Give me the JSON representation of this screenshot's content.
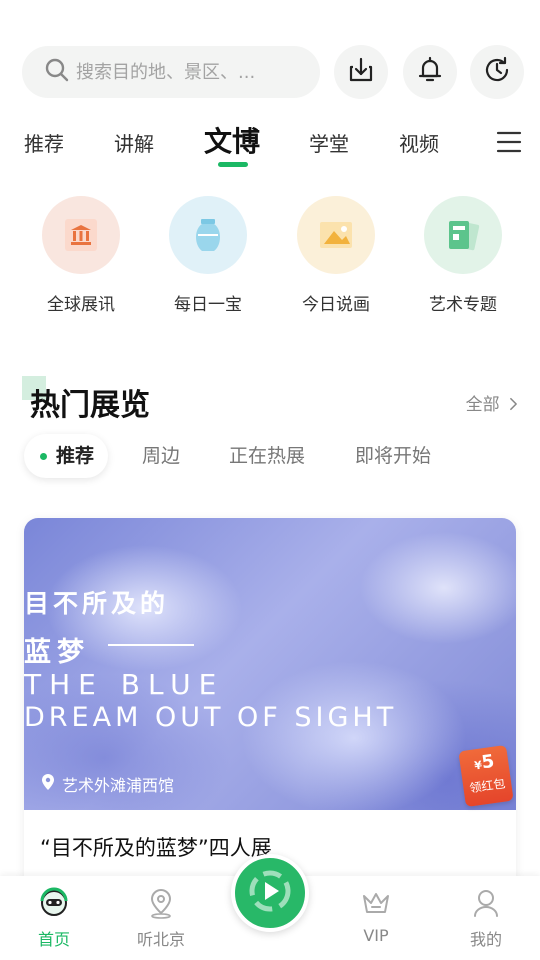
{
  "search": {
    "placeholder": "搜索目的地、景区、..."
  },
  "tabs": [
    {
      "label": "推荐"
    },
    {
      "label": "讲解"
    },
    {
      "label": "文博"
    },
    {
      "label": "学堂"
    },
    {
      "label": "视频"
    }
  ],
  "categories": [
    {
      "label": "全球展讯",
      "icon": "museum-icon",
      "color": "#f9e6df"
    },
    {
      "label": "每日一宝",
      "icon": "vase-icon",
      "color": "#e0f1f8"
    },
    {
      "label": "今日说画",
      "icon": "painting-icon",
      "color": "#fbf0d9"
    },
    {
      "label": "艺术专题",
      "icon": "cards-icon",
      "color": "#e2f3e8"
    }
  ],
  "section": {
    "title": "热门展览",
    "see_all": "全部"
  },
  "filters": [
    {
      "label": "推荐"
    },
    {
      "label": "周边"
    },
    {
      "label": "正在热展"
    },
    {
      "label": "即将开始"
    }
  ],
  "card": {
    "poster_line1": "目不所及的",
    "poster_line2": "蓝梦",
    "poster_line3": "THE BLUE",
    "poster_line4": "DREAM OUT OF SIGHT",
    "location": "艺术外滩浦西馆",
    "redpack_currency": "¥",
    "redpack_amount": "5",
    "redpack_label": "领红包",
    "title": "“目不所及的蓝梦”四人展"
  },
  "nav": [
    {
      "label": "首页"
    },
    {
      "label": "听北京"
    },
    {
      "label": "VIP"
    },
    {
      "label": "我的"
    }
  ],
  "colors": {
    "accent": "#1bb864"
  }
}
